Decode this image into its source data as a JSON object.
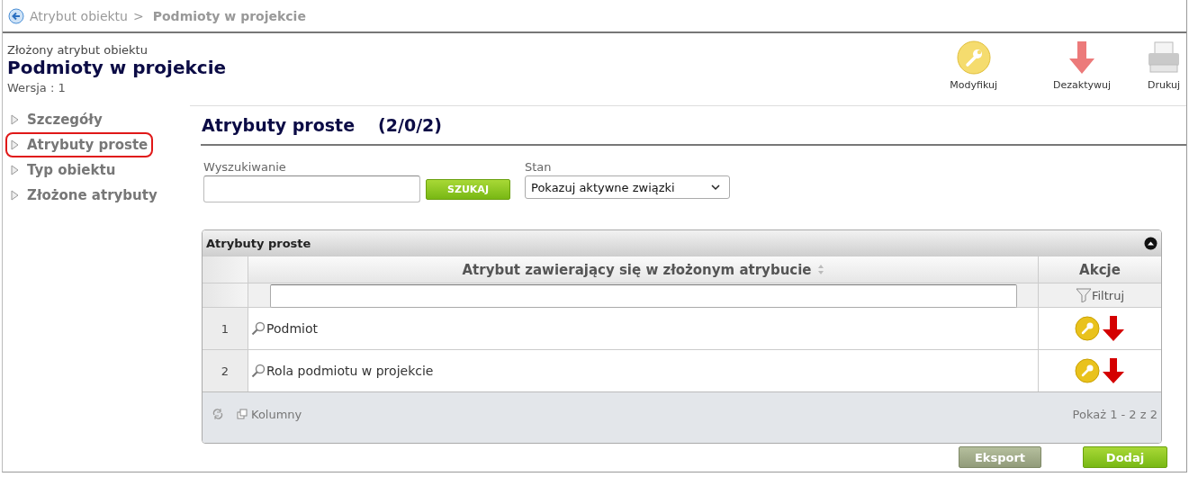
{
  "breadcrumb": {
    "parent": "Atrybut obiektu",
    "separator": ">",
    "current": "Podmioty w projekcie"
  },
  "header": {
    "subtitle": "Złożony atrybut obiektu",
    "title": "Podmioty w projekcie",
    "version": "Wersja : 1"
  },
  "toolbar": [
    {
      "label": "Modyfikuj",
      "kind": "modify"
    },
    {
      "label": "Dezaktywuj",
      "kind": "deactivate"
    },
    {
      "label": "Drukuj",
      "kind": "print"
    }
  ],
  "sidebar": {
    "items": [
      {
        "label": "Szczegóły",
        "selected": false
      },
      {
        "label": "Atrybuty proste",
        "selected": true
      },
      {
        "label": "Typ obiektu",
        "selected": false
      },
      {
        "label": "Złożone atrybuty",
        "selected": false
      }
    ]
  },
  "section": {
    "title": "Atrybuty proste",
    "count": "(2/0/2)"
  },
  "search": {
    "label": "Wyszukiwanie",
    "button": "SZUKAJ"
  },
  "state_filter": {
    "label": "Stan",
    "value": "Pokazuj aktywne związki"
  },
  "grid": {
    "caption": "Atrybuty proste",
    "columns": [
      "Atrybut zawierający się w złożonym atrybucie",
      "Akcje"
    ],
    "filter_button": "Filtruj",
    "rows": [
      {
        "number": "1",
        "name": "Podmiot"
      },
      {
        "number": "2",
        "name": "Rola podmiotu w projekcie"
      }
    ],
    "footer": {
      "columns_button": "Kolumny",
      "paging": "Pokaż 1 - 2 z 2"
    }
  },
  "buttons": [
    {
      "label": "Eksport",
      "kind": "export"
    },
    {
      "label": "Dodaj",
      "kind": "add"
    }
  ]
}
